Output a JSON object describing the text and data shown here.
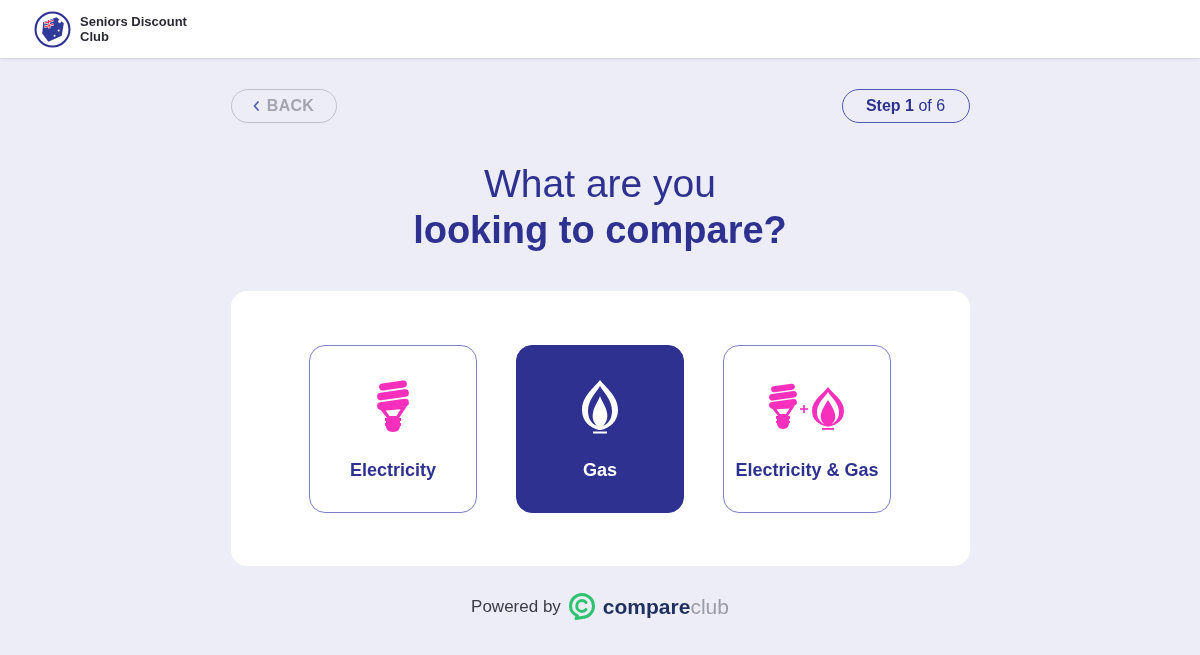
{
  "header": {
    "brand": "Seniors Discount Club"
  },
  "nav": {
    "back_label": "BACK",
    "step": "**Step 1** of 6"
  },
  "heading": {
    "line_1": "What are you",
    "line_2": "looking to compare?"
  },
  "options": [
    {
      "kind": "electricity",
      "label": "Electricity",
      "selected": false
    },
    {
      "kind": "gas",
      "label": "Gas",
      "selected": true
    },
    {
      "kind": "both",
      "label": "Electricity & Gas",
      "selected": false
    }
  ],
  "footer": {
    "powered_by": "Powered by",
    "brand": "**compare**club"
  }
}
